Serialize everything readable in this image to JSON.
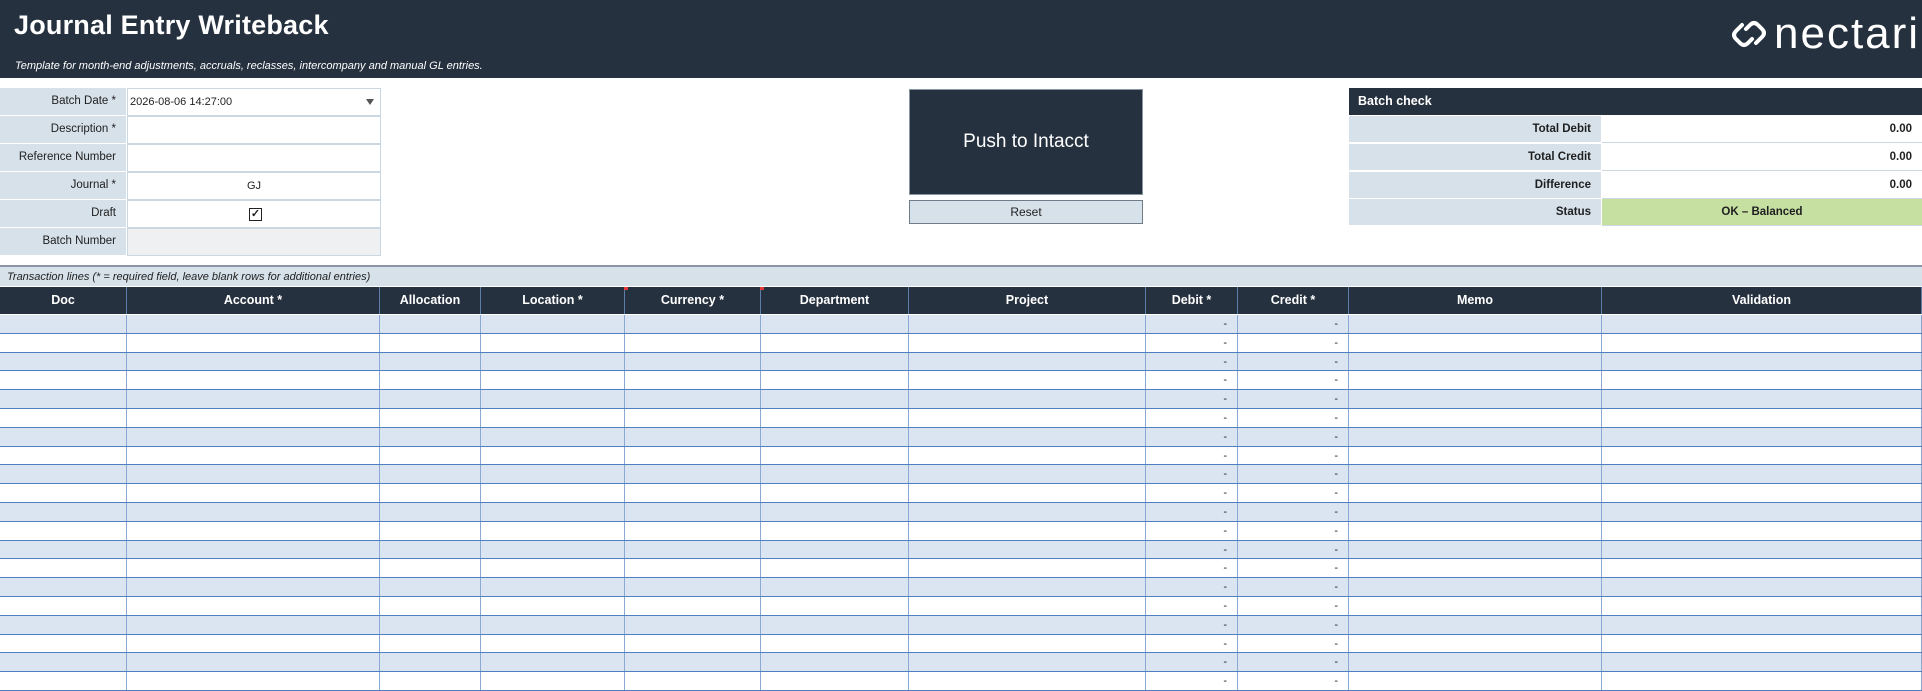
{
  "header": {
    "title": "Journal Entry Writeback",
    "subtitle": "Template for month-end adjustments, accruals, reclasses, intercompany and manual GL entries.",
    "logo_text": "nectari"
  },
  "form": {
    "batch_date_label": "Batch Date *",
    "batch_date_value": "2026-08-06 14:27:00",
    "description_label": "Description *",
    "description_value": "",
    "reference_label": "Reference Number",
    "reference_value": "",
    "journal_label": "Journal *",
    "journal_value": "GJ",
    "draft_label": "Draft",
    "draft_checked": "✓",
    "batch_number_label": "Batch Number",
    "batch_number_value": ""
  },
  "actions": {
    "push_label": "Push to Intacct",
    "reset_label": "Reset"
  },
  "batch_check": {
    "title": "Batch check",
    "total_debit_label": "Total Debit",
    "total_debit_value": "0.00",
    "total_credit_label": "Total Credit",
    "total_credit_value": "0.00",
    "difference_label": "Difference",
    "difference_value": "0.00",
    "status_label": "Status",
    "status_value": "OK – Balanced",
    "status_color": "#c6e0a1"
  },
  "transactions": {
    "caption": "Transaction lines   (* = required field, leave blank rows for additional entries)",
    "columns": [
      "Doc",
      "Account *",
      "Allocation",
      "Location *",
      "Currency *",
      "Department",
      "Project",
      "Debit *",
      "Credit *",
      "Memo",
      "Validation"
    ],
    "empty_amount": "-",
    "row_count": 20
  },
  "colors": {
    "header_bg": "#26313f",
    "label_bg": "#d6e1ea",
    "alt_row_bg": "#dbe5f1",
    "grid_line": "#4f7fc0"
  }
}
